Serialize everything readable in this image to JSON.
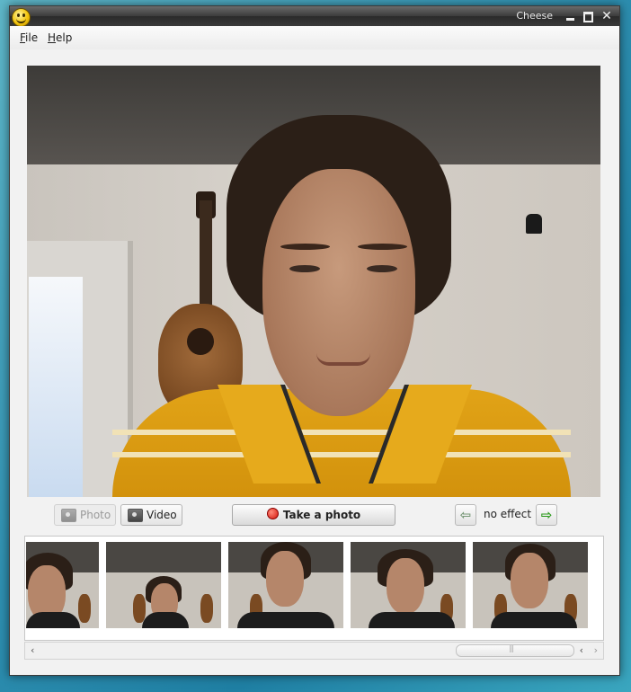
{
  "window": {
    "title": "Cheese",
    "controls": [
      "minimize-icon",
      "maximize-icon",
      "close-icon"
    ],
    "close_glyph": "✕",
    "app_icon": "smiley-icon"
  },
  "menubar": {
    "file": {
      "label": "File",
      "mnemonic": "F"
    },
    "help": {
      "label": "Help",
      "mnemonic": "H"
    }
  },
  "viewport": {
    "content": "webcam-live-preview"
  },
  "controls": {
    "photo_toggle": {
      "label": "Photo",
      "icon": "camera-icon",
      "state": "inactive"
    },
    "video_toggle": {
      "label": "Video",
      "icon": "video-camera-icon",
      "state": "active"
    },
    "take_photo": {
      "label": "Take a photo",
      "icon": "record-dot-icon"
    },
    "effect": {
      "label": "no effect",
      "prev_glyph": "⇦",
      "next_glyph": "⇨"
    }
  },
  "thumbnails": {
    "count": 5,
    "icon": "photo-thumbnail"
  },
  "scrollbar": {
    "left_glyph": "‹",
    "right_glyph": "›"
  },
  "colors": {
    "record_red": "#d4140a",
    "shirt_yellow": "#d8990f",
    "desktop_blue": "#2e8fb0"
  }
}
